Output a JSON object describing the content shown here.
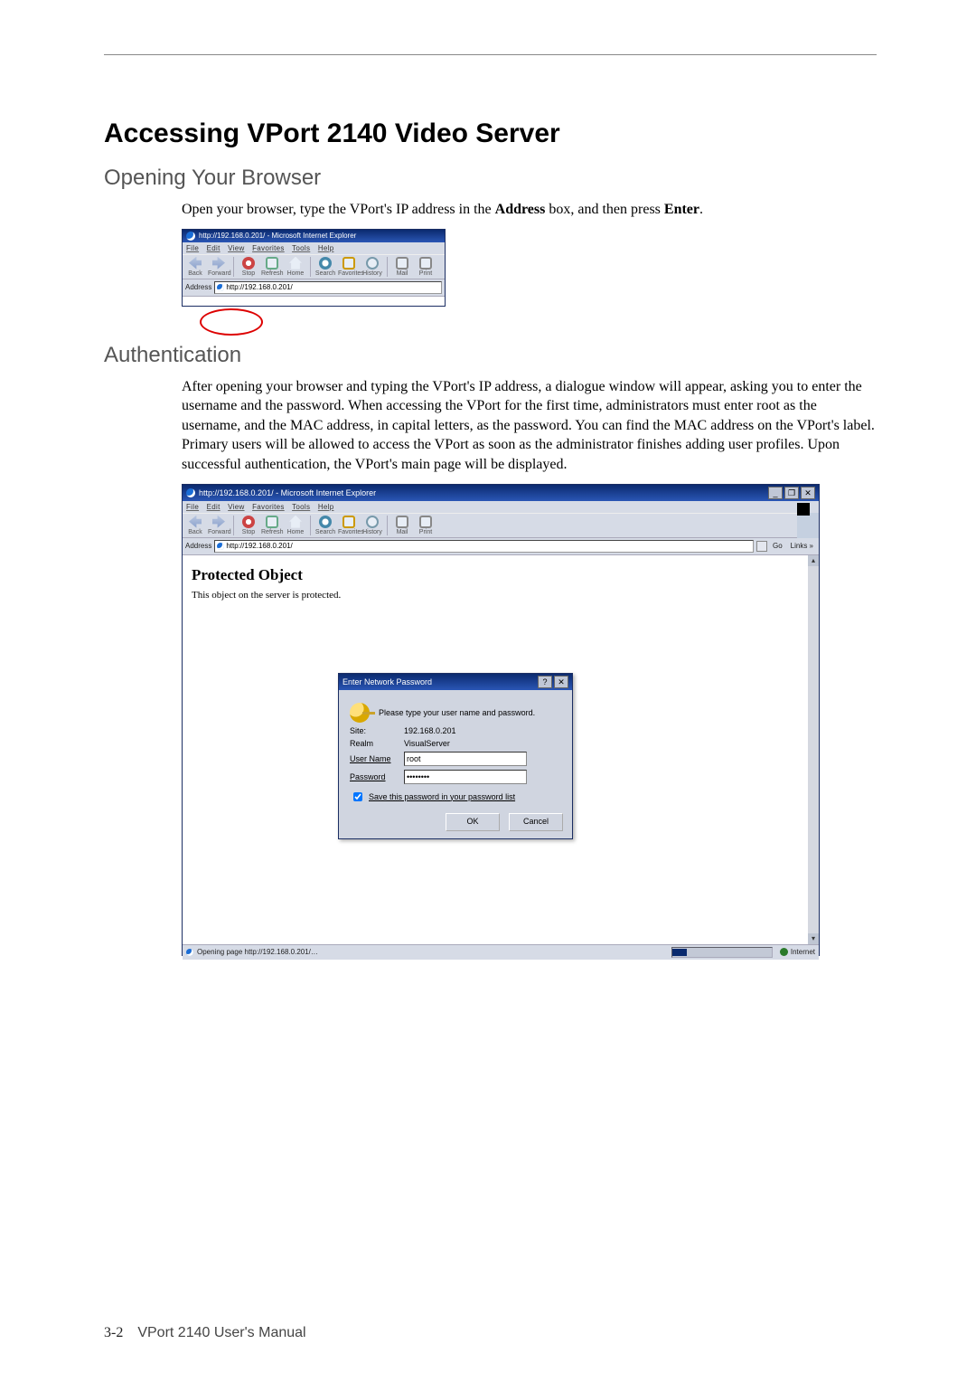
{
  "title": "Accessing VPort 2140 Video Server",
  "sections": {
    "opening": {
      "heading": "Opening Your Browser",
      "text_pre": "Open your browser, type the VPort's IP address in the ",
      "text_bold1": "Address",
      "text_mid": " box, and then press ",
      "text_bold2": "Enter",
      "text_post": "."
    },
    "auth": {
      "heading": "Authentication",
      "paragraph": "After opening your browser and typing the VPort's IP address, a dialogue window will appear, asking you to enter the username and the password. When accessing the VPort for the first time, administrators must enter root as the username, and the MAC address, in capital letters, as the password. You can find the MAC address on the VPort's label. Primary users will be allowed to access the VPort as soon as the administrator finishes adding user profiles. Upon successful authentication, the VPort's main page will be displayed."
    }
  },
  "ie": {
    "title_small": "http://192.168.0.201/ - Microsoft Internet Explorer",
    "title_large": "http://192.168.0.201/ - Microsoft Internet Explorer",
    "menu": {
      "file": "File",
      "edit": "Edit",
      "view": "View",
      "favorites": "Favorites",
      "tools": "Tools",
      "help": "Help"
    },
    "toolbar": {
      "back": "Back",
      "forward": "Forward",
      "stop": "Stop",
      "refresh": "Refresh",
      "home": "Home",
      "search": "Search",
      "favorites": "Favorites",
      "history": "History",
      "mail": "Mail",
      "print": "Print"
    },
    "address_label": "Address",
    "address_value": "http://192.168.0.201/",
    "go": "Go",
    "links": "Links »",
    "winbtns": {
      "min": "_",
      "max": "❐",
      "close": "✕"
    },
    "page": {
      "heading": "Protected Object",
      "subtext": "This object on the server is protected."
    },
    "status": {
      "text": "Opening page http://192.168.0.201/…",
      "zone": "Internet"
    },
    "corner_icon": "IE"
  },
  "dialog": {
    "title": "Enter Network Password",
    "help": "?",
    "close": "✕",
    "prompt": "Please type your user name and password.",
    "labels": {
      "site": "Site:",
      "realm": "Realm",
      "user": "User Name",
      "pass": "Password"
    },
    "values": {
      "site": "192.168.0.201",
      "realm": "VisualServer",
      "user": "root",
      "pass": "••••••••"
    },
    "save_label": "Save this password in your password list",
    "ok": "OK",
    "cancel": "Cancel"
  },
  "footer": {
    "page": "3-2",
    "doc": "VPort 2140 User's Manual"
  }
}
